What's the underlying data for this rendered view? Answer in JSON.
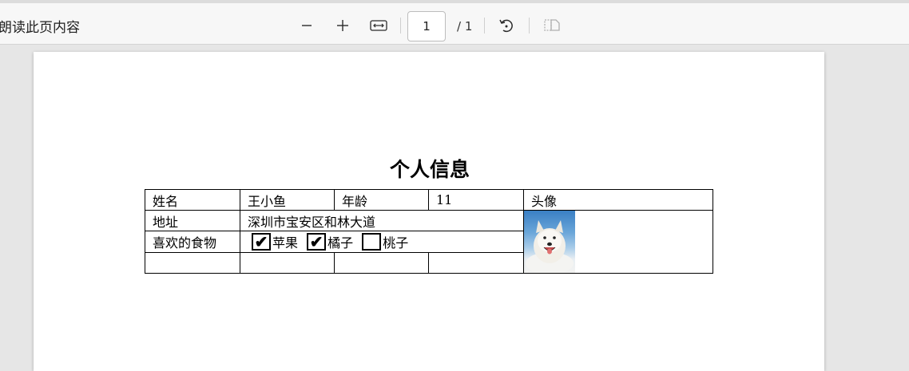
{
  "toolbar": {
    "read_aloud": "朗读此页内容",
    "zoom_out_icon": "minus-icon",
    "zoom_in_icon": "plus-icon",
    "fit_width_icon": "fit-width-icon",
    "current_page": "1",
    "total_pages": "/ 1",
    "rotate_icon": "rotate-icon",
    "two_page_icon": "two-page-icon"
  },
  "document": {
    "title": "个人信息",
    "labels": {
      "name": "姓名",
      "age": "年龄",
      "avatar": "头像",
      "address": "地址",
      "food": "喜欢的食物"
    },
    "values": {
      "name": "王小鱼",
      "age": "11",
      "address": "深圳市宝安区和林大道"
    },
    "foods": [
      {
        "label": "苹果",
        "checked": true,
        "mark": "✔"
      },
      {
        "label": "橘子",
        "checked": true,
        "mark": "✔"
      },
      {
        "label": "桃子",
        "checked": false,
        "mark": ""
      }
    ]
  }
}
